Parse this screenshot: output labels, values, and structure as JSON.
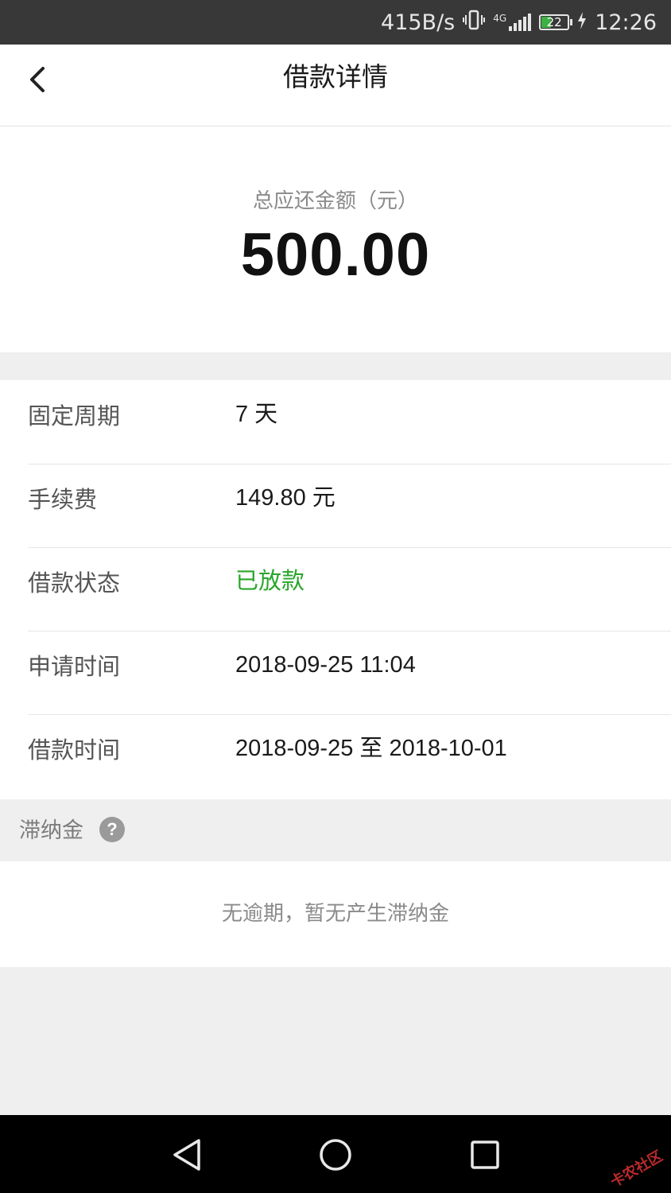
{
  "status_bar": {
    "net_speed": "415B/s",
    "network": "4G",
    "battery": "22",
    "time": "12:26"
  },
  "header": {
    "title": "借款详情",
    "back_icon": "chevron-left-icon"
  },
  "summary": {
    "label": "总应还金额（元）",
    "amount": "500.00"
  },
  "details": {
    "rows": [
      {
        "label": "固定周期",
        "value": "7 天"
      },
      {
        "label": "手续费",
        "value": "149.80 元"
      },
      {
        "label": "借款状态",
        "value": "已放款"
      },
      {
        "label": "申请时间",
        "value": "2018-09-25 11:04"
      },
      {
        "label": "借款时间",
        "value": "2018-09-25 至 2018-10-01"
      }
    ],
    "status_color": "#2aa52a"
  },
  "late_fee": {
    "label": "滞纳金",
    "help_symbol": "?",
    "message": "无逾期，暂无产生滞纳金"
  },
  "watermark": {
    "text": "卡农社区"
  },
  "colors": {
    "accent_green": "#2aa52a",
    "status_bar_bg": "#383838",
    "page_bg": "#efefef"
  }
}
